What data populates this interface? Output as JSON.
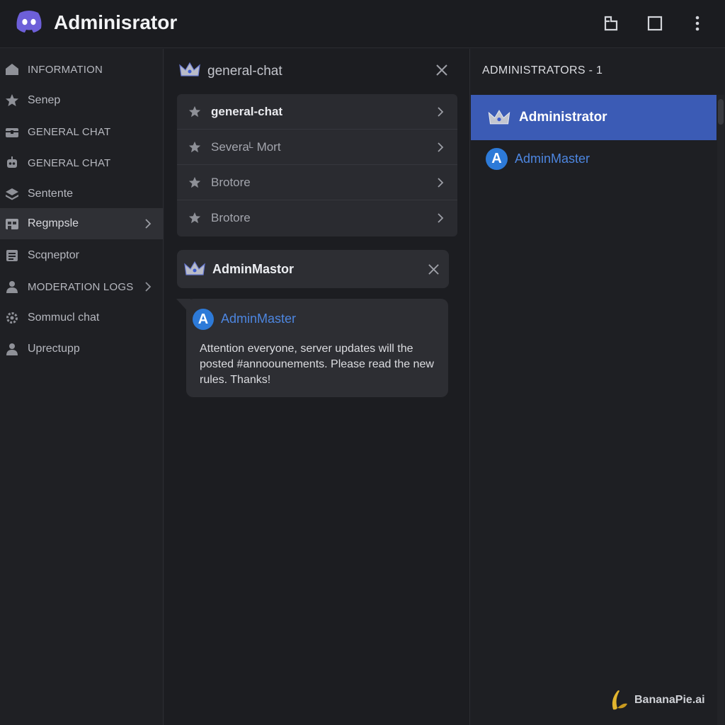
{
  "window": {
    "title": "Adminisrator",
    "icons": {
      "logo": "discord-logo-icon",
      "restore": "restore-window-icon",
      "maximize": "maximize-icon",
      "more": "kebab-menu-icon"
    }
  },
  "sidebar": {
    "items": [
      {
        "label": "INFORMATION",
        "icon": "home-icon"
      },
      {
        "label": "Senep",
        "icon": "star-icon"
      },
      {
        "label": "GENERAL CHAT",
        "icon": "chest-icon"
      },
      {
        "label": "GENERAL CHAT",
        "icon": "robot-icon"
      },
      {
        "label": "Sentente",
        "icon": "stack-icon"
      },
      {
        "label": "Regmpsle",
        "icon": "door-icon",
        "active": true,
        "has_chevron": true
      },
      {
        "label": "Scqneptor",
        "icon": "document-icon"
      },
      {
        "label": "MODERATION LOGS",
        "icon": "user-icon",
        "has_chevron": true
      },
      {
        "label": "Sommucl chat",
        "icon": "gear-icon"
      },
      {
        "label": "Uprectupp",
        "icon": "user-icon"
      }
    ]
  },
  "channel_panel": {
    "header_title": "general-chat",
    "channels": [
      {
        "label": "general-chat"
      },
      {
        "label": "Severaᴸ Mort"
      },
      {
        "label": "Brotore"
      },
      {
        "label": "Brotore"
      }
    ]
  },
  "dm": {
    "title": "AdminMastor"
  },
  "message": {
    "avatar_letter": "A",
    "author": "AdminMaster",
    "text": "Attention everyone, server updates will the posted #annoounements. Please read the new rules. Thanks!"
  },
  "members": {
    "header": "ADMINISTRATORS - 1",
    "role_label": "Administrator",
    "member_avatar_letter": "A",
    "member_name": "AdminMaster"
  },
  "watermark": {
    "text": "BananaPie.ai"
  },
  "colors": {
    "background": "#1e1f24",
    "accent_blue": "#3b5bb5",
    "link_blue": "#4d86e0",
    "avatar_blue": "#2d7ad8",
    "logo_purple": "#5865f2"
  }
}
